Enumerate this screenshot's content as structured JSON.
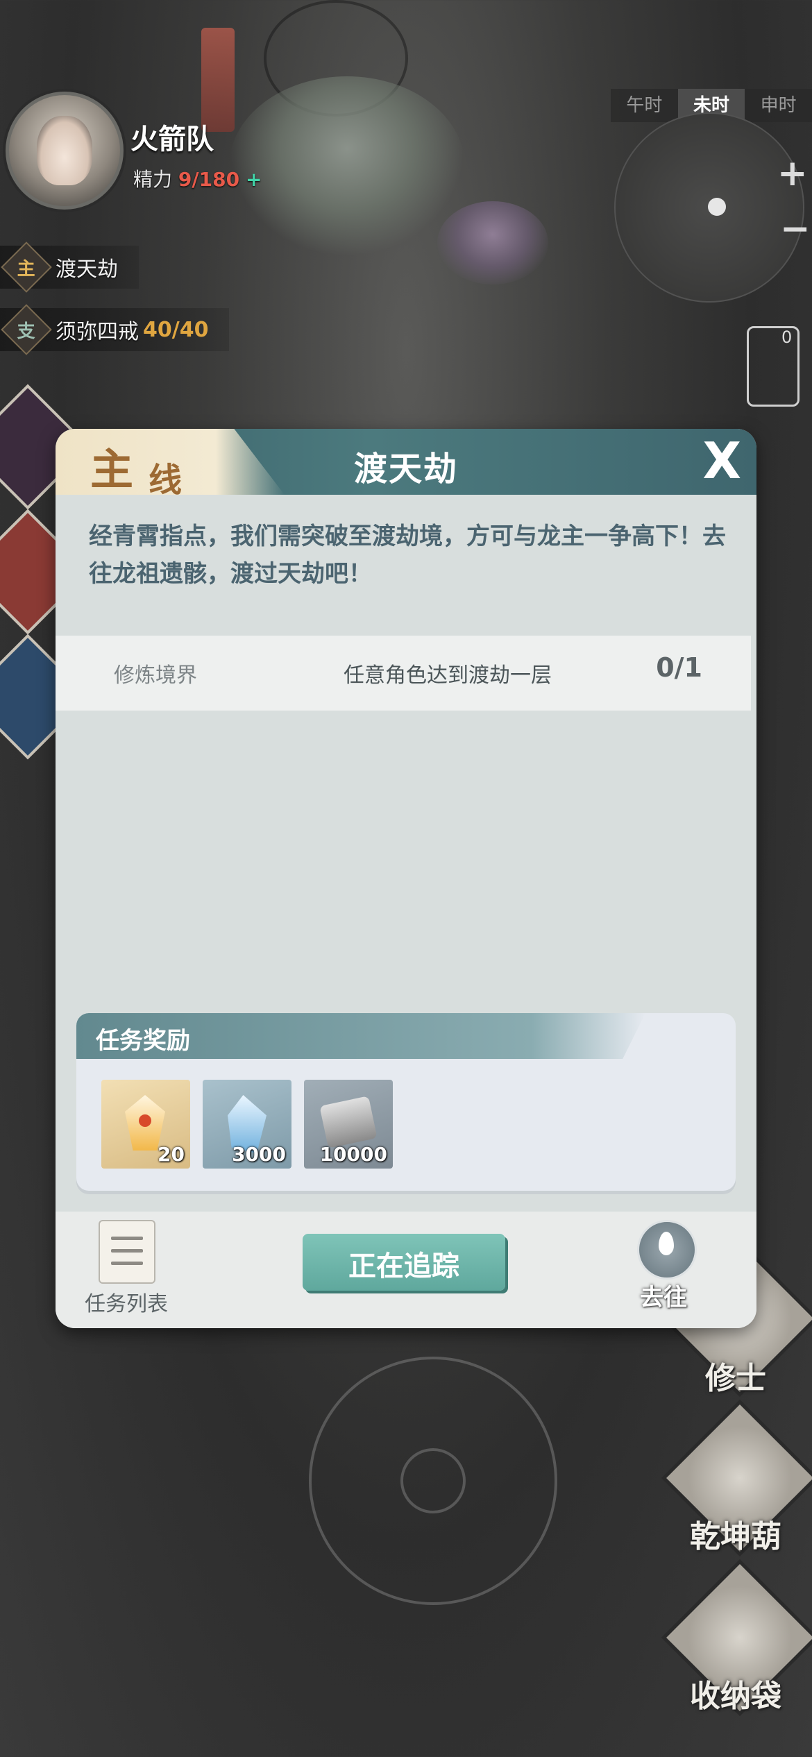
{
  "hud": {
    "player_name": "火箭队",
    "energy_label": "精力",
    "energy_value": "9/180",
    "energy_plus": "+",
    "main_quest_badge": "主",
    "main_quest_name": "渡天劫",
    "side_quest_badge": "支",
    "side_quest_name": "须弥四戒",
    "side_quest_progress": "40/40"
  },
  "minimap": {
    "time_tabs": [
      "午时",
      "未时",
      "申时"
    ],
    "active_tab": "未时",
    "zoom_in": "+",
    "zoom_out": "−",
    "notification_count": "0"
  },
  "right_menu": {
    "cultivator": "修士",
    "gourd": "乾坤葫",
    "bag": "收纳袋"
  },
  "modal": {
    "tab_big": "主",
    "tab_small": "线",
    "title": "渡天劫",
    "close": "X",
    "description": "经青霄指点，我们需突破至渡劫境，方可与龙主一争高下！去往龙祖遗骸，渡过天劫吧！",
    "objective": {
      "category": "修炼境界",
      "requirement": "任意角色达到渡劫一层",
      "progress": "0/1"
    },
    "rewards_title": "任务奖励",
    "rewards": [
      {
        "icon": "gold-gem-icon",
        "qty": "20"
      },
      {
        "icon": "blue-crystal-icon",
        "qty": "3000"
      },
      {
        "icon": "scroll-icon",
        "qty": "10000"
      }
    ],
    "footer": {
      "list_label": "任务列表",
      "track_button": "正在追踪",
      "goto_label": "去往"
    }
  },
  "colors": {
    "header_teal": "#4c7a7e",
    "accent_gold": "#9d6a33",
    "track_button": "#6fb6aa",
    "energy_red": "#e85a4a"
  }
}
